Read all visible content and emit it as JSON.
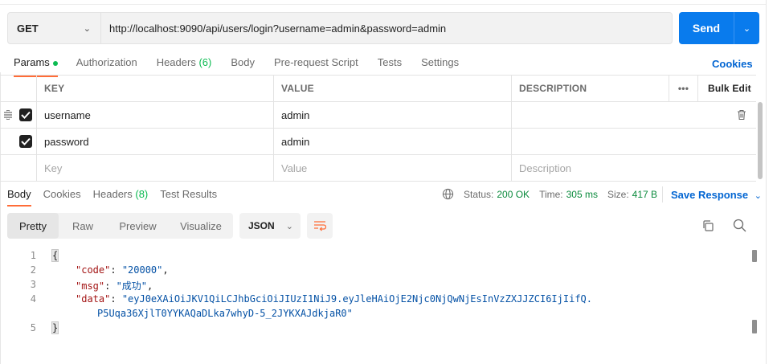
{
  "request": {
    "method": "GET",
    "url": "http://localhost:9090/api/users/login?username=admin&password=admin",
    "send_label": "Send"
  },
  "request_tabs": [
    {
      "label": "Params",
      "active": true
    },
    {
      "label": "Authorization"
    },
    {
      "label": "Headers",
      "count": "(6)"
    },
    {
      "label": "Body"
    },
    {
      "label": "Pre-request Script"
    },
    {
      "label": "Tests"
    },
    {
      "label": "Settings"
    }
  ],
  "cookies_label": "Cookies",
  "params": {
    "headers": {
      "key": "KEY",
      "value": "VALUE",
      "description": "DESCRIPTION",
      "more": "•••",
      "bulk_edit": "Bulk Edit"
    },
    "rows": [
      {
        "key": "username",
        "value": "admin",
        "checked": true
      },
      {
        "key": "password",
        "value": "admin",
        "checked": true
      }
    ],
    "placeholders": {
      "key": "Key",
      "value": "Value",
      "description": "Description"
    }
  },
  "response_tabs": [
    {
      "label": "Body",
      "active": true
    },
    {
      "label": "Cookies"
    },
    {
      "label": "Headers",
      "count": "(8)"
    },
    {
      "label": "Test Results"
    }
  ],
  "response_meta": {
    "status_label": "Status:",
    "status_value": "200 OK",
    "time_label": "Time:",
    "time_value": "305 ms",
    "size_label": "Size:",
    "size_value": "417 B",
    "save_response": "Save Response"
  },
  "view_modes": [
    "Pretty",
    "Raw",
    "Preview",
    "Visualize"
  ],
  "format": "JSON",
  "code": {
    "line_numbers": [
      "1",
      "2",
      "3",
      "4",
      "5"
    ],
    "open_brace": "{",
    "close_brace": "}",
    "code_key": "\"code\"",
    "code_value": "\"20000\"",
    "msg_key": "\"msg\"",
    "msg_value": "\"成功\"",
    "data_key": "\"data\"",
    "data_value_1": "\"eyJ0eXAiOiJKV1QiLCJhbGciOiJIUzI1NiJ9.eyJleHAiOjE2Njc0NjQwNjEsInVzZXJJZCI6IjIifQ.",
    "data_value_2": "P5Uqa36XjlT0YYKAQaDLka7whyD-5_2JYKXAJdkjaR0\""
  },
  "colors": {
    "accent": "#ff6c37",
    "send": "#097bed",
    "link": "#0265d2",
    "status_ok": "#0a8a3c",
    "json_key": "#a31515",
    "json_string": "#0451a5"
  }
}
